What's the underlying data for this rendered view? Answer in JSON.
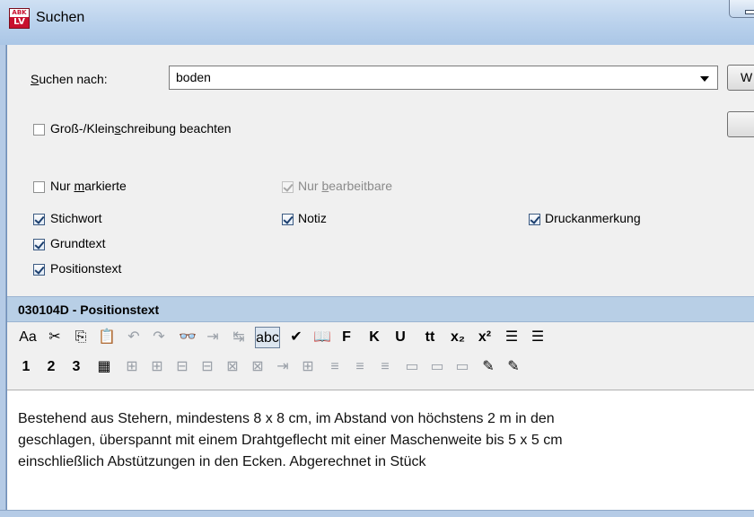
{
  "window": {
    "title": "Suchen",
    "icon_top": "ABK",
    "icon_bottom": "LV"
  },
  "search": {
    "label_prefix": "S",
    "label_rest": "uchen nach:",
    "value": "boden"
  },
  "buttons": {
    "primary_label": "W"
  },
  "options": {
    "case_sensitive": {
      "label_a": "Groß-/Klein",
      "label_u": "s",
      "label_b": "chreibung beachten",
      "checked": false
    },
    "only_marked": {
      "label_a": "Nur ",
      "label_u": "m",
      "label_b": "arkierte",
      "checked": false
    },
    "only_editable": {
      "label_a": "Nur ",
      "label_u": "b",
      "label_b": "earbeitbare",
      "checked": true,
      "enabled": false
    }
  },
  "fields": {
    "stichwort": {
      "label": "Stichwort",
      "checked": true
    },
    "notiz": {
      "label": "Notiz",
      "checked": true
    },
    "druckanmerkung": {
      "label": "Druckanmerkung",
      "checked": true
    },
    "grundtext": {
      "label": "Grundtext",
      "checked": true
    },
    "positionstext": {
      "label": "Positionstext",
      "checked": true
    }
  },
  "section": {
    "title": "030104D - Positionstext"
  },
  "toolbar1": [
    {
      "name": "font-size-icon",
      "glyph": "Aa",
      "dis": false
    },
    {
      "name": "cut-icon",
      "glyph": "✂",
      "dis": false
    },
    {
      "name": "copy-icon",
      "glyph": "⎘",
      "dis": false
    },
    {
      "name": "paste-icon",
      "glyph": "📋",
      "dis": false
    },
    {
      "name": "undo-icon",
      "glyph": "↶",
      "dis": true
    },
    {
      "name": "redo-icon",
      "glyph": "↷",
      "dis": true
    },
    {
      "name": "find-icon",
      "glyph": "👓",
      "dis": false
    },
    {
      "name": "find-next-icon",
      "glyph": "⇥",
      "dis": true
    },
    {
      "name": "replace-icon",
      "glyph": "↹",
      "dis": true
    },
    {
      "name": "spellcheck-toggle-icon",
      "glyph": "abc",
      "dis": false
    },
    {
      "name": "spellcheck-icon",
      "glyph": "✔",
      "dis": false
    },
    {
      "name": "dictionary-icon",
      "glyph": "📖",
      "dis": false
    },
    {
      "name": "bold-icon",
      "glyph": "F",
      "dis": false
    },
    {
      "name": "italic-icon",
      "glyph": "K",
      "dis": false
    },
    {
      "name": "underline-icon",
      "glyph": "U",
      "dis": false
    },
    {
      "name": "typewriter-icon",
      "glyph": "tt",
      "dis": false
    },
    {
      "name": "subscript-icon",
      "glyph": "x₂",
      "dis": false
    },
    {
      "name": "superscript-icon",
      "glyph": "x²",
      "dis": false
    },
    {
      "name": "numbered-list-icon",
      "glyph": "☰",
      "dis": false
    },
    {
      "name": "bullet-list-icon",
      "glyph": "☰",
      "dis": false
    }
  ],
  "toolbar2": [
    {
      "name": "heading-1-icon",
      "glyph": "1",
      "dis": false
    },
    {
      "name": "heading-2-icon",
      "glyph": "2",
      "dis": false
    },
    {
      "name": "heading-3-icon",
      "glyph": "3",
      "dis": false
    },
    {
      "name": "insert-table-icon",
      "glyph": "▦",
      "dis": false
    },
    {
      "name": "insert-row-above-icon",
      "glyph": "⊞",
      "dis": true
    },
    {
      "name": "insert-row-below-icon",
      "glyph": "⊞",
      "dis": true
    },
    {
      "name": "insert-column-left-icon",
      "glyph": "⊟",
      "dis": true
    },
    {
      "name": "insert-column-right-icon",
      "glyph": "⊟",
      "dis": true
    },
    {
      "name": "delete-row-icon",
      "glyph": "⊠",
      "dis": true
    },
    {
      "name": "delete-column-icon",
      "glyph": "⊠",
      "dis": true
    },
    {
      "name": "merge-cells-icon",
      "glyph": "⇥",
      "dis": true
    },
    {
      "name": "table-grid-icon",
      "glyph": "⊞",
      "dis": true
    },
    {
      "name": "align-left-icon",
      "glyph": "≡",
      "dis": true
    },
    {
      "name": "align-center-icon",
      "glyph": "≡",
      "dis": true
    },
    {
      "name": "align-right-icon",
      "glyph": "≡",
      "dis": true
    },
    {
      "name": "valign-top-icon",
      "glyph": "▭",
      "dis": true
    },
    {
      "name": "valign-middle-icon",
      "glyph": "▭",
      "dis": true
    },
    {
      "name": "valign-bottom-icon",
      "glyph": "▭",
      "dis": true
    },
    {
      "name": "highlight-icon",
      "glyph": "✎",
      "dis": false
    },
    {
      "name": "highlight-more-icon",
      "glyph": "✎",
      "dis": false
    }
  ],
  "editor": {
    "lines": [
      "Bestehend aus Stehern, mindestens 8 x 8 cm, im Abstand von höchstens 2 m in den",
      "geschlagen, überspannt mit einem Drahtgeflecht mit einer Maschenweite bis 5 x 5 cm",
      "einschließlich Abstützungen in den Ecken. Abgerechnet in Stück"
    ]
  }
}
